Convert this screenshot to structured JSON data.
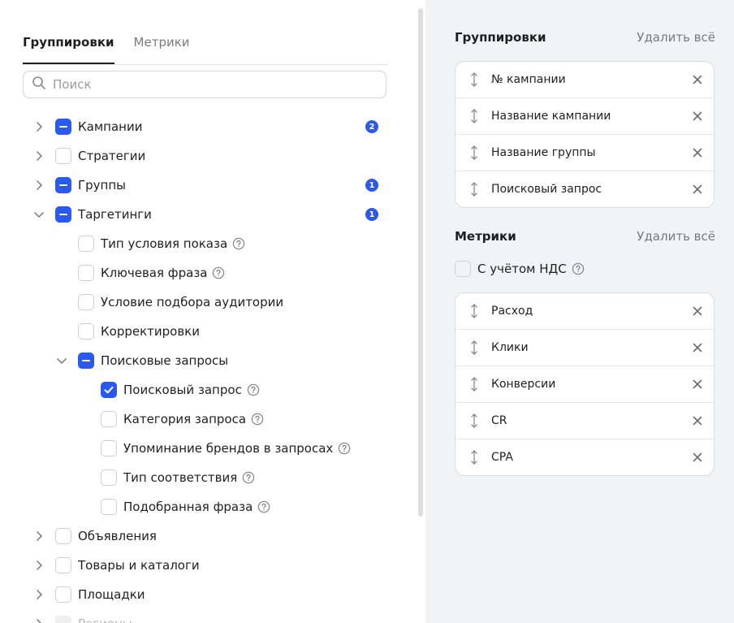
{
  "tabs": [
    {
      "label": "Группировки",
      "active": true
    },
    {
      "label": "Метрики",
      "active": false
    }
  ],
  "search": {
    "placeholder": "Поиск",
    "value": ""
  },
  "tree": [
    {
      "label": "Кампании",
      "state": "partial",
      "expand": "collapsed",
      "badge": "2",
      "help": false,
      "level": 0
    },
    {
      "label": "Стратегии",
      "state": "off",
      "expand": "collapsed",
      "badge": null,
      "help": false,
      "level": 0
    },
    {
      "label": "Группы",
      "state": "partial",
      "expand": "collapsed",
      "badge": "1",
      "help": false,
      "level": 0
    },
    {
      "label": "Таргетинги",
      "state": "partial",
      "expand": "expanded",
      "badge": "1",
      "help": false,
      "level": 0
    },
    {
      "label": "Тип условия показа",
      "state": "off",
      "expand": "none",
      "badge": null,
      "help": true,
      "level": 1
    },
    {
      "label": "Ключевая фраза",
      "state": "off",
      "expand": "none",
      "badge": null,
      "help": true,
      "level": 1
    },
    {
      "label": "Условие подбора аудитории",
      "state": "off",
      "expand": "none",
      "badge": null,
      "help": false,
      "level": 1
    },
    {
      "label": "Корректировки",
      "state": "off",
      "expand": "none",
      "badge": null,
      "help": false,
      "level": 1
    },
    {
      "label": "Поисковые запросы",
      "state": "partial",
      "expand": "expanded",
      "badge": null,
      "help": false,
      "level": 1
    },
    {
      "label": "Поисковый запрос",
      "state": "checked",
      "expand": "none",
      "badge": null,
      "help": true,
      "level": 2
    },
    {
      "label": "Категория запроса",
      "state": "off",
      "expand": "none",
      "badge": null,
      "help": true,
      "level": 2
    },
    {
      "label": "Упоминание брендов в запросах",
      "state": "off",
      "expand": "none",
      "badge": null,
      "help": true,
      "level": 2
    },
    {
      "label": "Тип соответствия",
      "state": "off",
      "expand": "none",
      "badge": null,
      "help": true,
      "level": 2
    },
    {
      "label": "Подобранная фраза",
      "state": "off",
      "expand": "none",
      "badge": null,
      "help": true,
      "level": 2
    },
    {
      "label": "Объявления",
      "state": "off",
      "expand": "collapsed",
      "badge": null,
      "help": false,
      "level": 0
    },
    {
      "label": "Товары и каталоги",
      "state": "off",
      "expand": "collapsed",
      "badge": null,
      "help": false,
      "level": 0
    },
    {
      "label": "Площадки",
      "state": "off",
      "expand": "collapsed",
      "badge": null,
      "help": false,
      "level": 0
    },
    {
      "label": "Регионы",
      "state": "disabled",
      "expand": "collapsed",
      "badge": null,
      "help": false,
      "level": 0
    }
  ],
  "groupings": {
    "title": "Группировки",
    "delete_all": "Удалить всё",
    "items": [
      "№ кампании",
      "Название кампании",
      "Название группы",
      "Поисковый запрос"
    ]
  },
  "metrics": {
    "title": "Метрики",
    "delete_all": "Удалить всё",
    "vat_label": "С учётом НДС",
    "vat_checked": false,
    "items": [
      "Расход",
      "Клики",
      "Конверсии",
      "CR",
      "CPA"
    ]
  },
  "colors": {
    "accent": "#2a59f0",
    "panel_bg": "#f2f3f5",
    "muted_text": "#7a7a7a"
  }
}
